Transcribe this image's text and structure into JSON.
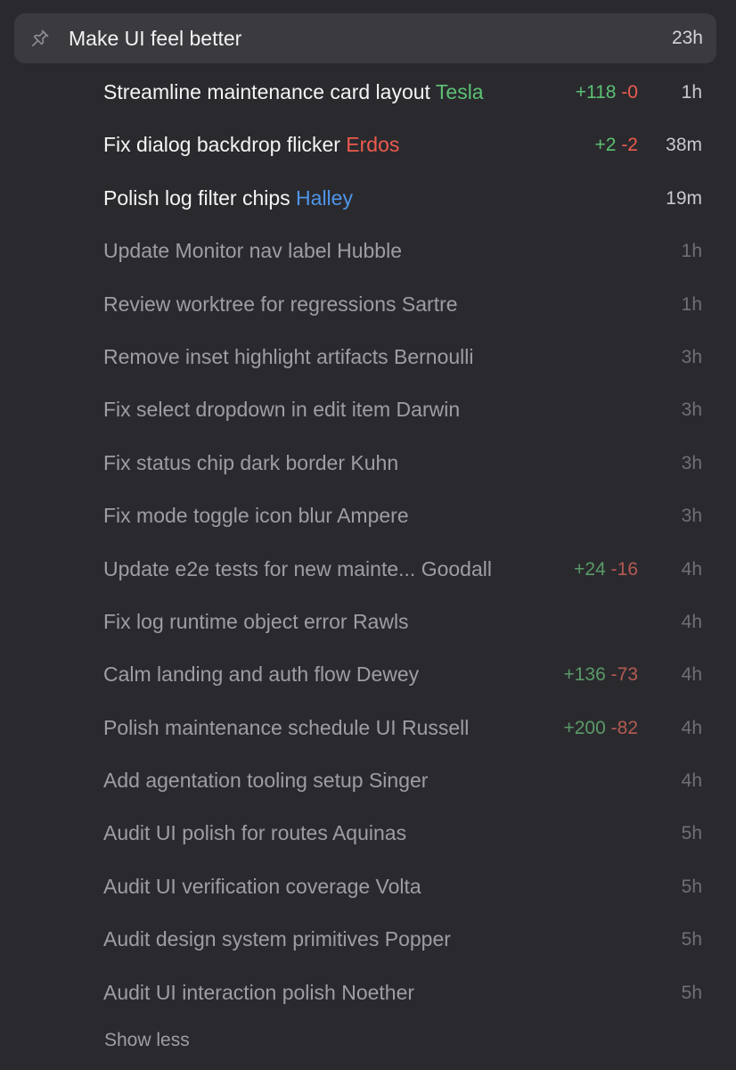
{
  "pinned": {
    "title": "Make UI feel better",
    "time": "23h",
    "icon": "pin-icon"
  },
  "colors": {
    "background": "#2a2a2e",
    "pinned_background": "#3a3a3f",
    "additions": "#5cc073",
    "deletions": "#ee5a4e",
    "agent_green": "#5cc073",
    "agent_red": "#ee5a4e",
    "agent_blue": "#4f94e8"
  },
  "tasks": [
    {
      "title": "Streamline maintenance card layout",
      "agent": "Tesla",
      "agent_color": "#5cc073",
      "additions": "+118",
      "deletions": "-0",
      "time": "1h",
      "active": true
    },
    {
      "title": "Fix dialog backdrop flicker",
      "agent": "Erdos",
      "agent_color": "#ee5a4e",
      "additions": "+2",
      "deletions": "-2",
      "time": "38m",
      "active": true
    },
    {
      "title": "Polish log filter chips",
      "agent": "Halley",
      "agent_color": "#4f94e8",
      "additions": "",
      "deletions": "",
      "time": "19m",
      "active": true
    },
    {
      "title": "Update Monitor nav label",
      "agent": "Hubble",
      "agent_color": "",
      "additions": "",
      "deletions": "",
      "time": "1h",
      "active": false
    },
    {
      "title": "Review worktree for regressions",
      "agent": "Sartre",
      "agent_color": "",
      "additions": "",
      "deletions": "",
      "time": "1h",
      "active": false
    },
    {
      "title": "Remove inset highlight artifacts",
      "agent": "Bernoulli",
      "agent_color": "",
      "additions": "",
      "deletions": "",
      "time": "3h",
      "active": false
    },
    {
      "title": "Fix select dropdown in edit item",
      "agent": "Darwin",
      "agent_color": "",
      "additions": "",
      "deletions": "",
      "time": "3h",
      "active": false
    },
    {
      "title": "Fix status chip dark border",
      "agent": "Kuhn",
      "agent_color": "",
      "additions": "",
      "deletions": "",
      "time": "3h",
      "active": false
    },
    {
      "title": "Fix mode toggle icon blur",
      "agent": "Ampere",
      "agent_color": "",
      "additions": "",
      "deletions": "",
      "time": "3h",
      "active": false
    },
    {
      "title": "Update e2e tests for new mainte...",
      "agent": "Goodall",
      "agent_color": "",
      "additions": "+24",
      "deletions": "-16",
      "time": "4h",
      "active": false
    },
    {
      "title": "Fix log runtime object error",
      "agent": "Rawls",
      "agent_color": "",
      "additions": "",
      "deletions": "",
      "time": "4h",
      "active": false
    },
    {
      "title": "Calm landing and auth flow",
      "agent": "Dewey",
      "agent_color": "",
      "additions": "+136",
      "deletions": "-73",
      "time": "4h",
      "active": false
    },
    {
      "title": "Polish maintenance schedule UI",
      "agent": "Russell",
      "agent_color": "",
      "additions": "+200",
      "deletions": "-82",
      "time": "4h",
      "active": false
    },
    {
      "title": "Add agentation tooling setup",
      "agent": "Singer",
      "agent_color": "",
      "additions": "",
      "deletions": "",
      "time": "4h",
      "active": false
    },
    {
      "title": "Audit UI polish for routes",
      "agent": "Aquinas",
      "agent_color": "",
      "additions": "",
      "deletions": "",
      "time": "5h",
      "active": false
    },
    {
      "title": "Audit UI verification coverage",
      "agent": "Volta",
      "agent_color": "",
      "additions": "",
      "deletions": "",
      "time": "5h",
      "active": false
    },
    {
      "title": "Audit design system primitives",
      "agent": "Popper",
      "agent_color": "",
      "additions": "",
      "deletions": "",
      "time": "5h",
      "active": false
    },
    {
      "title": "Audit UI interaction polish",
      "agent": "Noether",
      "agent_color": "",
      "additions": "",
      "deletions": "",
      "time": "5h",
      "active": false
    }
  ],
  "footer": {
    "show_less_label": "Show less"
  }
}
